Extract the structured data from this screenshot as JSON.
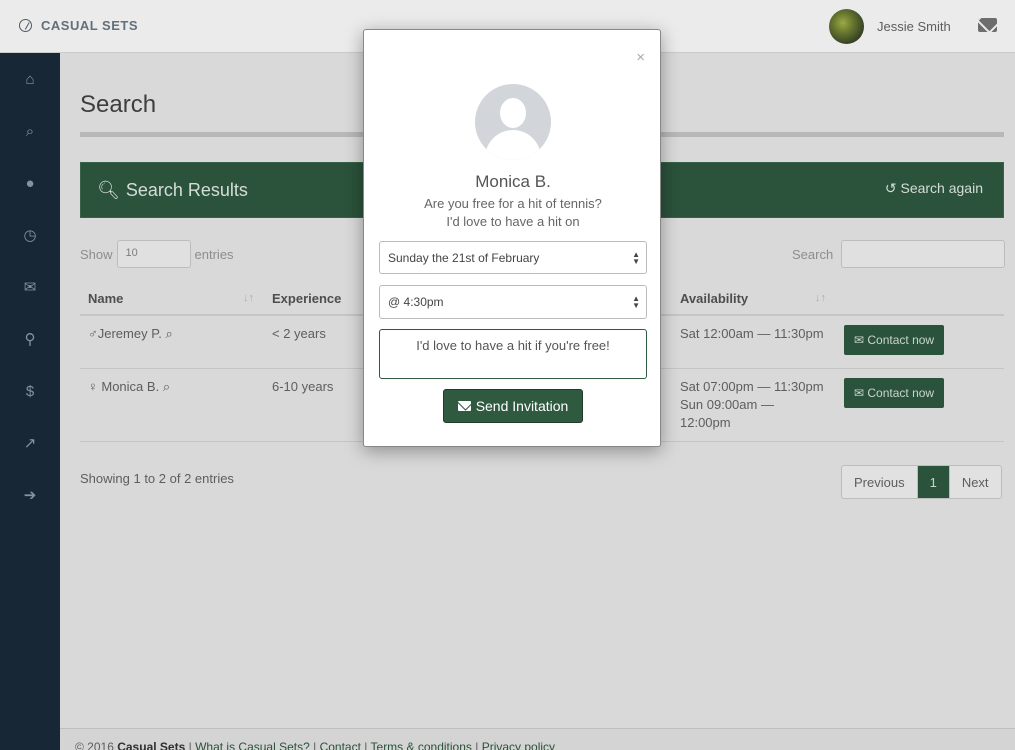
{
  "brand": {
    "name": "CASUAL SETS"
  },
  "user": {
    "name": "Jessie Smith"
  },
  "sidebar": {
    "items": [
      {
        "icon": "home-icon",
        "glyph": "⌂"
      },
      {
        "icon": "search-icon",
        "glyph": "⌕"
      },
      {
        "icon": "user-icon",
        "glyph": "●"
      },
      {
        "icon": "clock-icon",
        "glyph": "◷"
      },
      {
        "icon": "envelope-icon",
        "glyph": "✉"
      },
      {
        "icon": "map-marker-icon",
        "glyph": "⚲"
      },
      {
        "icon": "dollar-icon",
        "glyph": "$"
      },
      {
        "icon": "chart-icon",
        "glyph": "↗"
      },
      {
        "icon": "sign-out-icon",
        "glyph": "➔"
      }
    ]
  },
  "page": {
    "title": "Search"
  },
  "panel": {
    "title": "Search Results",
    "again": "Search again"
  },
  "table_controls": {
    "show_label": "Show",
    "show_value": "10",
    "entries_label": "entries",
    "search_label": "Search"
  },
  "table": {
    "columns": [
      "Name",
      "Experience",
      "Availability"
    ],
    "rows": [
      {
        "name": "Jeremey P.",
        "experience": "< 2 years",
        "availability": [
          "Sat 12:00am — 11:30pm"
        ],
        "action": "Contact now"
      },
      {
        "name": "Monica B.",
        "experience": "6-10 years",
        "availability": [
          "Sat 07:00pm — 11:30pm",
          "Sun 09:00am —",
          "12:00pm"
        ],
        "action": "Contact now"
      }
    ]
  },
  "footer_info": {
    "showing": "Showing 1 to 2 of 2 entries"
  },
  "pagination": {
    "previous": "Previous",
    "page": "1",
    "next": "Next"
  },
  "footer": {
    "copyright": "© 2016",
    "brand": "Casual Sets",
    "links": [
      "What is Casual Sets?",
      "Contact",
      "Terms & conditions",
      "Privacy policy"
    ]
  },
  "modal": {
    "close": "×",
    "name": "Monica B.",
    "line1": "Are you free for a hit of tennis?",
    "line2": "I'd love to have a hit on",
    "date_value": "Sunday the 21st of February",
    "time_value": "@ 4:30pm",
    "message": "I'd love to have a hit if you're free!",
    "send_label": "Send Invitation"
  },
  "colors": {
    "accent": "#2f5a40",
    "sidebar": "#1a2b3a"
  }
}
